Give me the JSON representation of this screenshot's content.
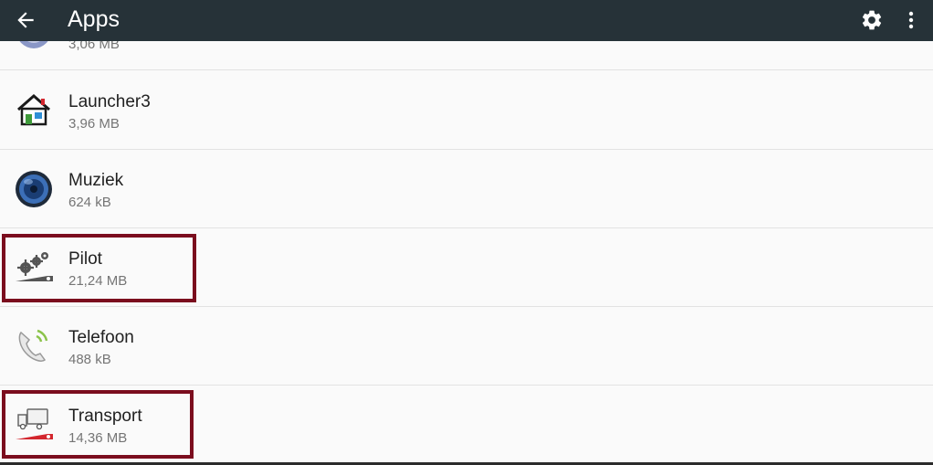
{
  "toolbar": {
    "title": "Apps",
    "background": "#263238",
    "icons": [
      "arrow-back-icon",
      "gear-icon",
      "more-vert-icon"
    ]
  },
  "apps": [
    {
      "name": "",
      "size": "3,06 MB",
      "icon": "partial-app-icon"
    },
    {
      "name": "Launcher3",
      "size": "3,96 MB",
      "icon": "house-icon"
    },
    {
      "name": "Muziek",
      "size": "624 kB",
      "icon": "speaker-icon"
    },
    {
      "name": "Pilot",
      "size": "21,24 MB",
      "icon": "gears-icon",
      "highlighted": true
    },
    {
      "name": "Telefoon",
      "size": "488 kB",
      "icon": "phone-icon"
    },
    {
      "name": "Transport",
      "size": "14,36 MB",
      "icon": "truck-icon",
      "highlighted": true
    }
  ],
  "colors": {
    "highlight": "#7b0d1e",
    "list_background": "#fafafa",
    "divider": "#e2e2e2"
  }
}
